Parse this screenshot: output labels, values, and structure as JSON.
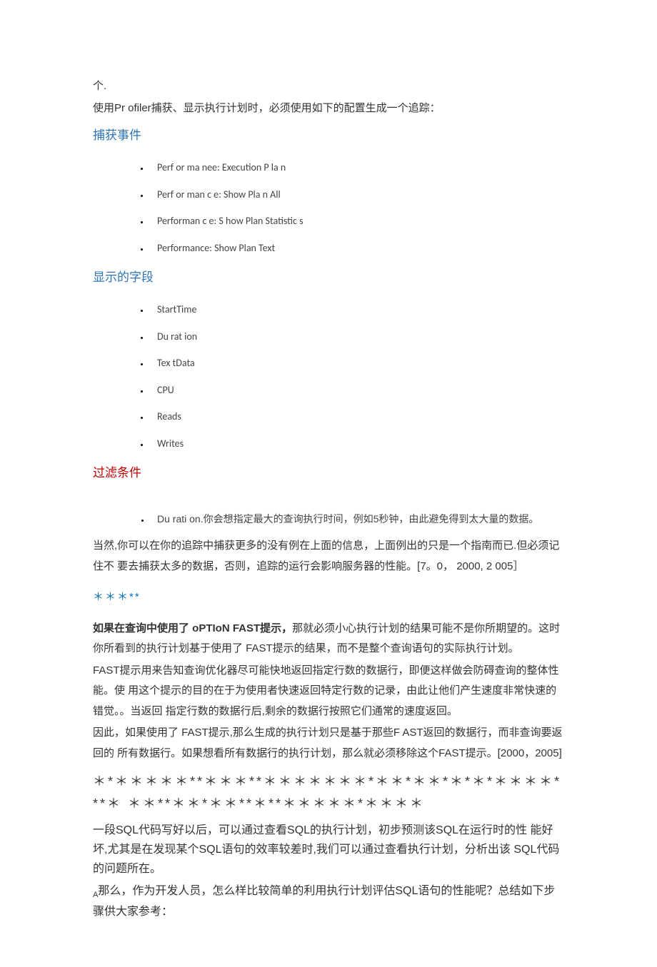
{
  "intro": {
    "line1": "个.",
    "line2": "使用Pr ofiler捕获、显示执行计划时，必须使用如下的配置生成一个追踪："
  },
  "section1": {
    "heading": "捕获事件",
    "items": [
      "Perf or ma nee: Execution P  la  n",
      "Perf or man  c  e: Show Pla  n  All",
      " Performan  c  e: S  how Plan Statistic  s",
      "Performance: Show Plan Text"
    ]
  },
  "section2": {
    "heading": "显示的字段",
    "items": [
      "StartTime",
      "Du  rat  ion",
      "Tex tData",
      "CPU",
      "Reads",
      "Writes"
    ]
  },
  "section3": {
    "heading": "过滤条件",
    "items": [
      "Du rati on.你会想指定最大的查询执行时间，例如5秒钟，由此避免得到太大量的数据。"
    ]
  },
  "body1": "当然,你可以在你的追踪中捕获更多的没有例在上面的信息，上面例出的只是一个指南而已.但必须记住不  要去捕获太多的数据，否则，追踪的运行会影响服务器的性能。[7。0，        2000, 2 005］",
  "stars1": "＊＊＊**",
  "body2_bold": "如果在查询中使用了 oPTIoN FAST提示，",
  "body2_rest": "那就必须小心执行计划的结果可能不是你所期望的。这时  你所看到的执行计划基于使用了 FAST提示的结果，而不是整个查询语句的实际执行计划。",
  "body3": "FAST提示用来告知查询优化器尽可能快地返回指定行数的数据行，即便这样做会防碍查询的整体性能。使  用这个提示的目的在于为使用者快速返回特定行数的记录，由此让他们产生速度非常快速的错觉。。当返回  指定行数的数据行后,剩余的数据行按照它们通常的速度返回。",
  "body4": "因此，如果使用了 FAST提示,那么生成的执行计划只是基于那些F AST返回的数据行，而非查询要返回的  所有数据行。如果想看所有数据行的执行计划，那么就必须移除这个FAST提示。[2000，2005]",
  "bigstars": " ＊*＊＊＊＊＊**＊＊＊**＊＊＊＊＊＊＊*＊＊*＊＊*＊*＊*＊＊＊＊***＊   ＊＊**＊＊*＊＊**＊**＊＊＊＊＊*＊＊＊＊",
  "closing": {
    "p1": "一段SQL代码写好以后，可以通过查看SQL的执行计划，初步预测该SQL在运行时的性  能好坏,尤其是在发现某个SQL语句的效率较差时,我们可以通过查看执行计划，分析出该   SQL代码的问题所在。",
    "p2_prefix": "A",
    "p2": "那么，作为开发人员，怎么样比较简单的利用执行计划评估SQL语句的性能呢？总结如下步骤供大家参考："
  }
}
